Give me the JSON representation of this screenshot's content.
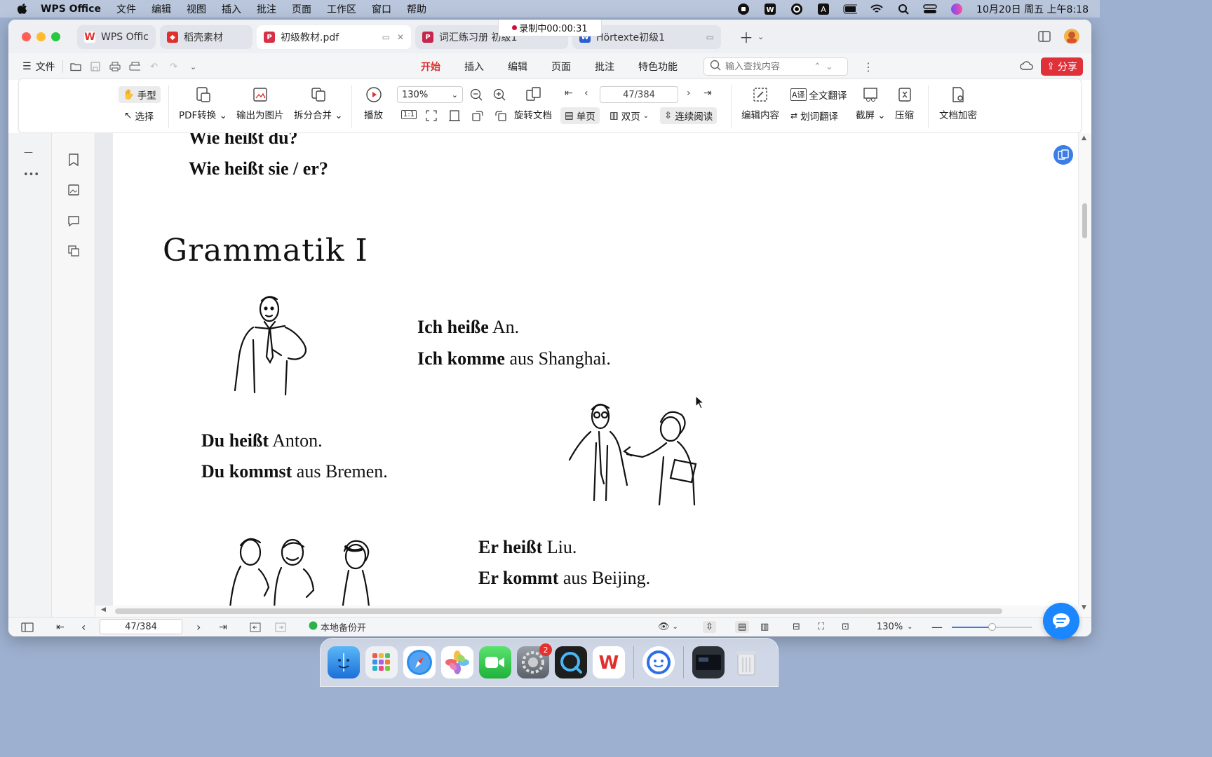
{
  "menubar": {
    "app_name": "WPS Office",
    "items": [
      "文件",
      "编辑",
      "视图",
      "插入",
      "批注",
      "页面",
      "工作区",
      "窗口",
      "帮助"
    ],
    "clock": "10月20日 周五 上午8:18"
  },
  "recording": {
    "label": "录制中00:00:31"
  },
  "tabs": [
    {
      "label": "WPS Office",
      "icon_color": "#e0302e"
    },
    {
      "label": "稻壳素材",
      "icon_color": "#e0302e"
    },
    {
      "label": "初级教材.pdf",
      "icon_color": "#d9304a"
    },
    {
      "label": "词汇练习册 初级1",
      "icon_color": "#c8254c"
    },
    {
      "label": "Hörtexte初级1",
      "icon_color": "#2b5fcf"
    }
  ],
  "toolbar": {
    "file_label": "文件",
    "menu_tabs": [
      "开始",
      "插入",
      "编辑",
      "页面",
      "批注",
      "特色功能"
    ],
    "active_tab": "开始",
    "search_placeholder": "输入查找内容",
    "share_label": "分享"
  },
  "ribbon": {
    "hand_label": "手型",
    "select_label": "选择",
    "pdf_convert_label": "PDF转换",
    "export_image_label": "输出为图片",
    "split_merge_label": "拆分合并",
    "play_label": "播放",
    "zoom_value": "130%",
    "rotate_label": "旋转文档",
    "page_value": "47/384",
    "single_page_label": "单页",
    "double_page_label": "双页",
    "continuous_label": "连续阅读",
    "edit_content_label": "编辑内容",
    "full_translate_label": "全文翻译",
    "word_translate_label": "划词翻译",
    "screenshot_label": "截屏",
    "compress_label": "压缩",
    "encrypt_label": "文档加密"
  },
  "document": {
    "line_top1": "Wie heißt du?",
    "line_top2": "Wie heißt sie / er?",
    "heading": "Grammatik Ⅰ",
    "block1": {
      "bold1": "Ich heiße",
      "rest1": " An.",
      "bold2": "Ich komme",
      "rest2": " aus Shanghai."
    },
    "block2": {
      "bold1": "Du heißt",
      "rest1": " Anton.",
      "bold2": "Du kommst",
      "rest2": " aus Bremen."
    },
    "block3": {
      "bold1": "Er heißt",
      "rest1": " Liu.",
      "bold2": "Er kommt",
      "rest2": " aus Beijing."
    }
  },
  "statusbar": {
    "page_value": "47/384",
    "backup_label": "本地备份开",
    "zoom_value": "130%",
    "zoom_fraction": 0.5
  },
  "dock": {
    "badge_count": "2"
  }
}
